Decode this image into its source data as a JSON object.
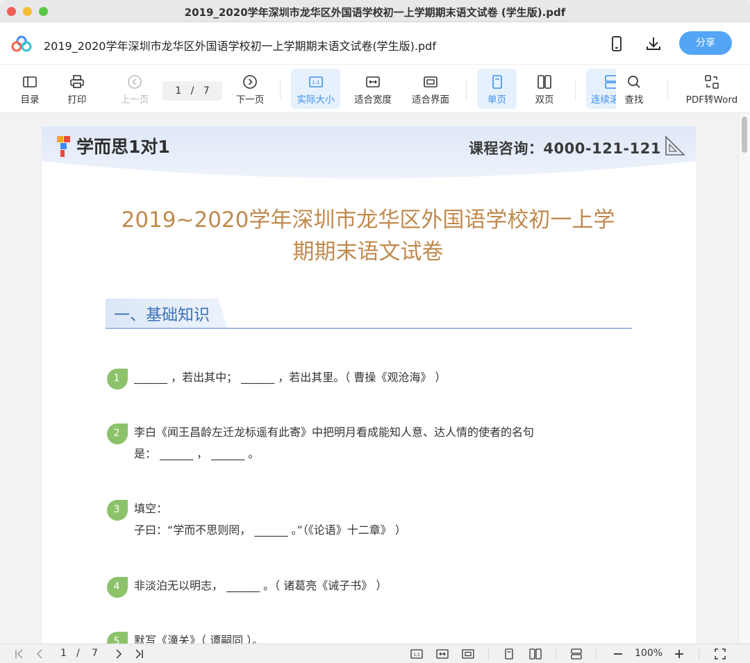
{
  "window": {
    "title": "2019_2020学年深圳市龙华区外国语学校初一上学期期末语文试卷 (学生版).pdf"
  },
  "header": {
    "doc_title": "2019_2020学年深圳市龙华区外国语学校初一上学期期末语文试卷(学生版).pdf",
    "share_label": "分享",
    "icons": [
      "cloud-logo-icon",
      "phone-icon",
      "download-icon"
    ]
  },
  "toolbar": {
    "toc": "目录",
    "print": "打印",
    "prev": "上一页",
    "page_current": "1",
    "page_sep": "/",
    "page_total": "7",
    "next": "下一页",
    "actual_size": "实际大小",
    "fit_width": "适合宽度",
    "fit_screen": "适合界面",
    "single_page": "单页",
    "double_page": "双页",
    "continuous": "连续滚",
    "search": "查找",
    "pdf_to_word": "PDF转Word",
    "active_color": "#3b8ff1"
  },
  "page": {
    "brand": "学而思1对1",
    "consult": "课程咨询：4000-121-121",
    "title_line1": "2019~2020学年深圳市龙华区外国语学校初一上学",
    "title_line2": "期期末语文试卷",
    "section": "一、基础知识",
    "questions": [
      {
        "num": "1",
        "lines": [
          "______ ，若出其中； ______ ，若出其里。（ 曹操《观沧海》 ）"
        ]
      },
      {
        "num": "2",
        "lines": [
          "李白《闻王昌龄左迁龙标遥有此寄》中把明月看成能知人意、达人情的使者的名句",
          "是： ______ ， ______ 。"
        ]
      },
      {
        "num": "3",
        "lines": [
          "填空：",
          "子曰：“学而不思则罔， ______ 。”（《论语》十二章》 ）"
        ]
      },
      {
        "num": "4",
        "lines": [
          "非淡泊无以明志， ______ 。（ 诸葛亮《诫子书》 ）"
        ]
      },
      {
        "num": "5",
        "lines": [
          "默写《潼关》（ 谭嗣同 ）。"
        ]
      }
    ],
    "title_color": "#c08a4e",
    "section_color": "#3c6fb6",
    "badge_color": "#8cc26a"
  },
  "statusbar": {
    "page_current": "1",
    "page_sep": "/",
    "page_total": "7",
    "zoom": "100%"
  }
}
